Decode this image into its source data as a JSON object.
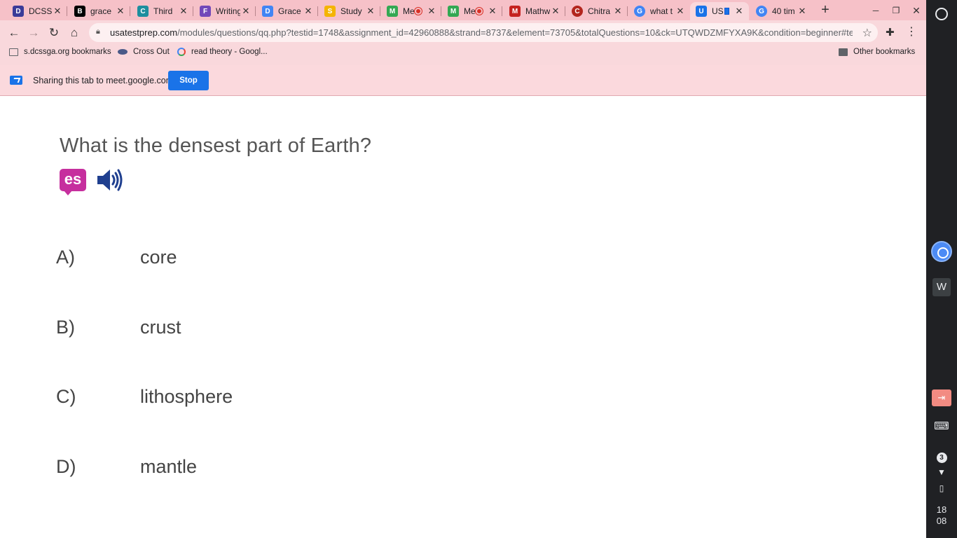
{
  "tabs": [
    {
      "title": "DCSS",
      "favicon_color": "#3b3b98",
      "favicon_glyph": "D"
    },
    {
      "title": "grace",
      "favicon_color": "#000000",
      "favicon_glyph": "B"
    },
    {
      "title": "Third",
      "favicon_color": "#1e8e9e",
      "favicon_glyph": "C"
    },
    {
      "title": "Writing",
      "favicon_color": "#7248b9",
      "favicon_glyph": "F"
    },
    {
      "title": "Grace",
      "favicon_color": "#4285f4",
      "favicon_glyph": "D"
    },
    {
      "title": "Study",
      "favicon_color": "#f4b400",
      "favicon_glyph": "S"
    },
    {
      "title": "Me",
      "favicon_color": "#34a853",
      "favicon_glyph": "M",
      "recording": true
    },
    {
      "title": "Me",
      "favicon_color": "#34a853",
      "favicon_glyph": "M",
      "recording": true
    },
    {
      "title": "Mathw",
      "favicon_color": "#c5221f",
      "favicon_glyph": "M"
    },
    {
      "title": "Chitra",
      "favicon_color": "#b3261e",
      "favicon_glyph": "C"
    },
    {
      "title": "what t",
      "favicon_color": "#4285f4",
      "favicon_glyph": "G"
    },
    {
      "title": "US",
      "favicon_color": "#1a73e8",
      "favicon_glyph": "U",
      "active": true
    },
    {
      "title": "40 tim",
      "favicon_color": "#4285f4",
      "favicon_glyph": "G"
    }
  ],
  "toolbar": {
    "url_host": "usatestprep.com",
    "url_rest": "/modules/questions/qq.php?testid=1748&assignment_id=42960888&strand=8737&element=73705&totalQuestions=10&ck=UTQWDZMFYXA9K&condition=beginner#tea..."
  },
  "bookmarks": {
    "items": [
      "s.dcssga.org bookmarks",
      "Cross Out",
      "read theory - Googl..."
    ],
    "other": "Other bookmarks"
  },
  "sharebar": {
    "message": "Sharing this tab to meet.google.com",
    "stop_label": "Stop"
  },
  "quiz": {
    "question": "What is the densest part of Earth?",
    "translate_icon_text": "es",
    "choices": [
      {
        "letter": "A)",
        "text": "core"
      },
      {
        "letter": "B)",
        "text": "crust"
      },
      {
        "letter": "C)",
        "text": "lithosphere"
      },
      {
        "letter": "D)",
        "text": "mantle"
      }
    ]
  },
  "shelf": {
    "w_app_label": "W",
    "notification_count": "3",
    "clock_hour": "18",
    "clock_minute": "08"
  }
}
